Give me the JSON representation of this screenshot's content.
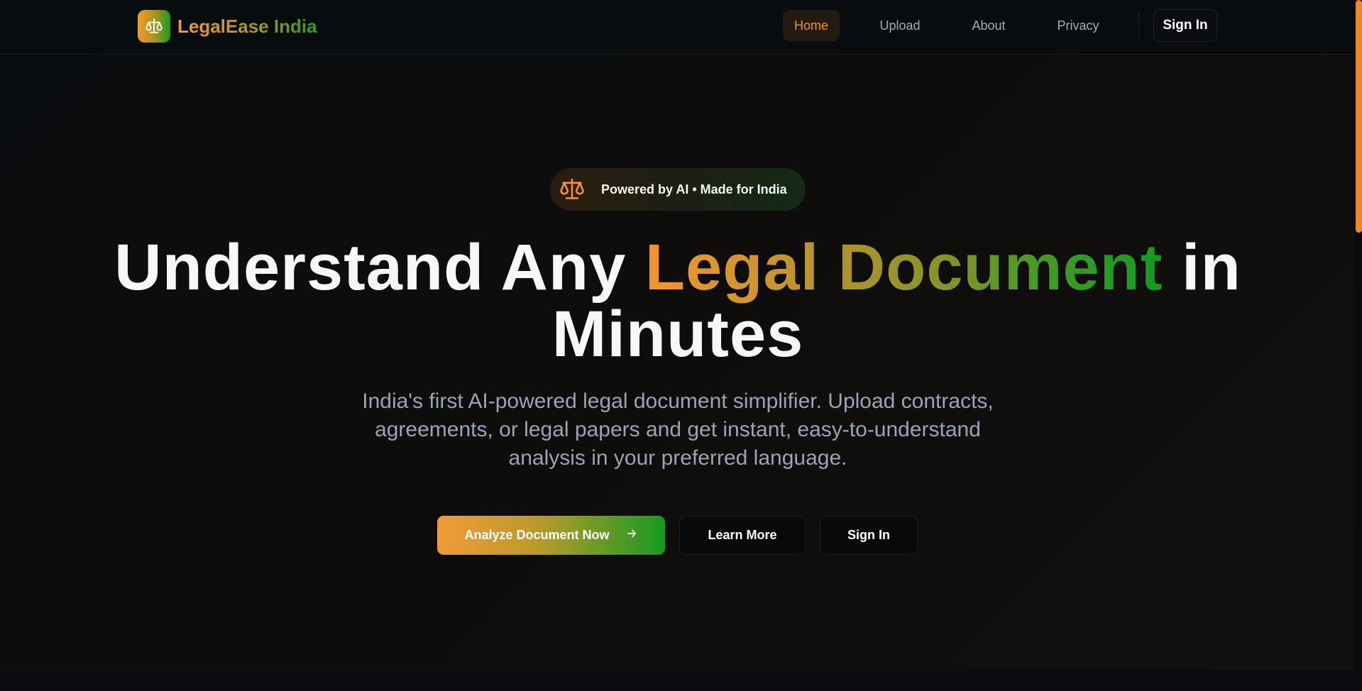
{
  "brand": {
    "name": "LegalEase India",
    "icon": "scales-icon"
  },
  "nav": {
    "items": [
      {
        "label": "Home",
        "active": true
      },
      {
        "label": "Upload",
        "active": false
      },
      {
        "label": "About",
        "active": false
      },
      {
        "label": "Privacy",
        "active": false
      }
    ],
    "sign_in": "Sign In"
  },
  "hero": {
    "badge": {
      "icon": "scales-icon",
      "text": "Powered by AI • Made for India"
    },
    "headline": {
      "part1": "Understand Any ",
      "highlight": "Legal Document",
      "part2": " in Minutes"
    },
    "subtitle": "India's first AI-powered legal document simplifier. Upload contracts, agreements, or legal papers and get instant, easy-to-understand analysis in your preferred language.",
    "buttons": {
      "primary": "Analyze Document Now",
      "primary_icon": "arrow-right-icon",
      "learn_more": "Learn More",
      "sign_in": "Sign In"
    }
  },
  "colors": {
    "accent_orange": "#f39a2e",
    "accent_green": "#139a22",
    "background": "#0b0d10"
  }
}
